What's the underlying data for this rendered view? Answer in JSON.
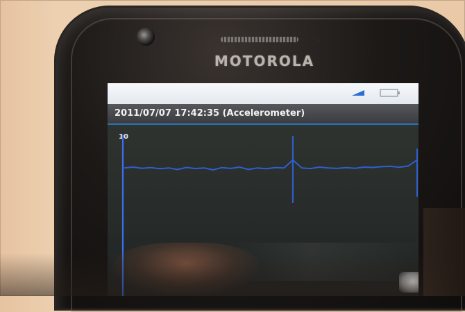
{
  "device": {
    "brand": "MOTOROLA",
    "earpiece_text": "",
    "status_left": "",
    "colors": {
      "phone_body": "#1c1917",
      "status_bar": "#eef1f5",
      "title_bar": "#48494c",
      "graph_background": "#2a2f2d",
      "trace": "#2f5fd0",
      "axis": "#3a6ef0"
    }
  },
  "app": {
    "title": "2011/07/07 17:42:35 (Accelerometer)",
    "y_axis_top_label": "10",
    "icons": [
      "signal-icon",
      "battery-icon"
    ]
  },
  "chart_data": {
    "type": "line",
    "title": "2011/07/07 17:42:35 (Accelerometer)",
    "xlabel": "",
    "ylabel": "",
    "ylim": [
      0,
      10
    ],
    "grid": false,
    "series": [
      {
        "values": [
          8.0,
          8.05,
          7.98,
          8.02,
          7.95,
          8.0,
          7.9,
          8.03,
          7.96,
          8.0,
          7.88,
          8.02,
          7.97,
          8.05,
          7.9,
          8.0,
          7.95,
          8.02,
          8.0,
          8.5,
          8.0,
          7.96,
          8.05,
          8.0,
          7.97,
          8.02,
          7.98,
          8.05,
          8.03,
          8.08,
          8.1,
          8.04,
          8.12,
          8.5
        ]
      }
    ],
    "spikes": [
      {
        "at_index": 19,
        "low": 5.8,
        "high": 10.0
      },
      {
        "at_index": 33,
        "low": 6.2,
        "high": 9.2
      }
    ]
  }
}
